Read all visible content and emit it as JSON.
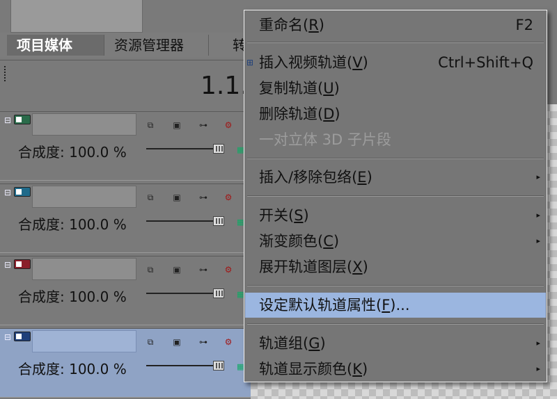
{
  "tabs": [
    {
      "label": "项目媒体"
    },
    {
      "label": "资源管理器"
    },
    {
      "label": "转"
    }
  ],
  "timecode": "1.1.",
  "tracks": [
    {
      "compositing_label": "合成度: 100.0 %"
    },
    {
      "compositing_label": "合成度: 100.0 %"
    },
    {
      "compositing_label": "合成度: 100.0 %"
    },
    {
      "compositing_label": "合成度: 100.0 %"
    }
  ],
  "menu": {
    "items": [
      {
        "label": "重命名(",
        "key": "R",
        "suffix": ")",
        "shortcut": "F2"
      },
      {
        "label": "插入视频轨道(",
        "key": "V",
        "suffix": ")",
        "shortcut": "Ctrl+Shift+Q"
      },
      {
        "label": "复制轨道(",
        "key": "U",
        "suffix": ")"
      },
      {
        "label": "删除轨道(",
        "key": "D",
        "suffix": ")"
      },
      {
        "label": "一对立体 3D 子片段",
        "disabled": true
      },
      {
        "label": "插入/移除包络(",
        "key": "E",
        "suffix": ")",
        "submenu": true
      },
      {
        "label": "开关(",
        "key": "S",
        "suffix": ")",
        "submenu": true
      },
      {
        "label": "渐变颜色(",
        "key": "C",
        "suffix": ")",
        "submenu": true
      },
      {
        "label": "展开轨道图层(",
        "key": "X",
        "suffix": ")"
      },
      {
        "label": "设定默认轨道属性(",
        "key": "F",
        "suffix": ")...",
        "highlighted": true
      },
      {
        "label": "轨道组(",
        "key": "G",
        "suffix": ")",
        "submenu": true
      },
      {
        "label": "轨道显示颜色(",
        "key": "K",
        "suffix": ")",
        "submenu": true
      }
    ]
  },
  "colors": {
    "panel_bg": "#7a7a7a",
    "menu_bg": "#767676",
    "highlight": "#9bb6e0",
    "selected_track": "#8fa3c5"
  }
}
